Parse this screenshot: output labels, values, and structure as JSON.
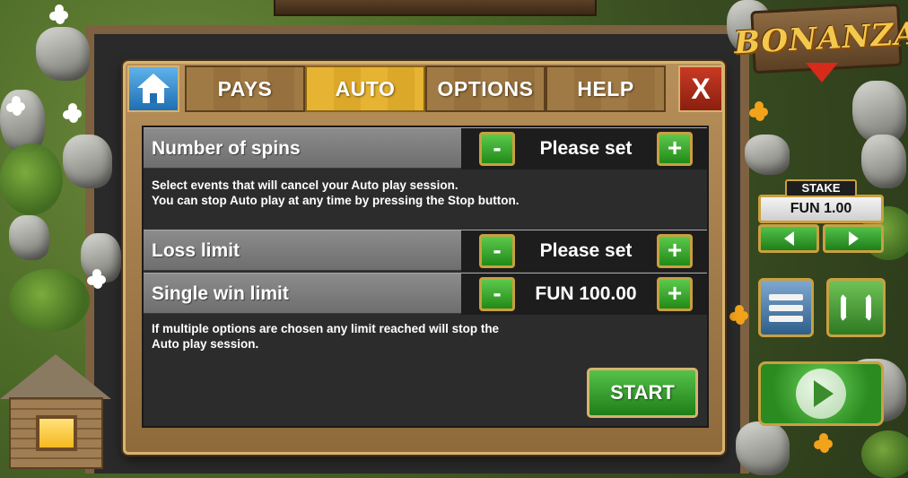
{
  "game": {
    "logo": "BONANZA"
  },
  "tabs": {
    "home_icon": "home-icon",
    "pays": "PAYS",
    "auto": "AUTO",
    "options": "OPTIONS",
    "help": "HELP",
    "close": "X",
    "active": "auto"
  },
  "auto_panel": {
    "spins": {
      "label": "Number of spins",
      "value": "Please set",
      "minus": "-",
      "plus": "+"
    },
    "cancel_info": {
      "line1": "Select events that will cancel your Auto play session.",
      "line2": "You can stop Auto play at any time by pressing the Stop button."
    },
    "loss_limit": {
      "label": "Loss limit",
      "value": "Please set",
      "minus": "-",
      "plus": "+"
    },
    "single_win_limit": {
      "label": "Single win limit",
      "value": "FUN 100.00",
      "minus": "-",
      "plus": "+"
    },
    "limit_info": {
      "line1": "If multiple options are chosen any limit reached will stop the",
      "line2": "Auto play session."
    },
    "start": "START"
  },
  "controls": {
    "stake_label": "STAKE",
    "stake_value": "FUN 1.00",
    "stake_decrease_icon": "arrow-left-icon",
    "stake_increase_icon": "arrow-right-icon",
    "menu_icon": "menu-icon",
    "autoplay_icon": "autoplay-icon",
    "spin_icon": "play-icon"
  },
  "colors": {
    "active_tab": "#e7b332",
    "button_green": "#3aa62e",
    "close_red": "#b8301c",
    "home_blue": "#2f86c8",
    "gold_border": "#c9a040"
  }
}
